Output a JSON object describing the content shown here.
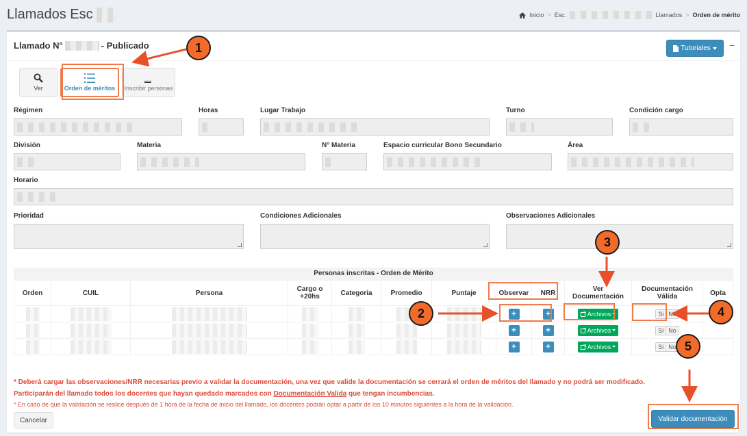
{
  "header": {
    "title": "Llamados Esc",
    "breadcrumb": {
      "home": "Inicio",
      "item2": "Esc.",
      "item3": "Llamados",
      "current": "Orden de mérito",
      "separator": ">"
    }
  },
  "box": {
    "title_prefix": "Llamado N°",
    "title_suffix": "- Publicado",
    "tutoriales": "Tutoriales",
    "collapse": "−"
  },
  "tools": [
    {
      "label": "Ver",
      "icon": "search-icon"
    },
    {
      "label": "Orden de méritos",
      "icon": "list-ordered-icon"
    },
    {
      "label": "Inscribir personas",
      "icon": "book-icon"
    }
  ],
  "form": {
    "regimen": "Régimen",
    "horas": "Horas",
    "lugar_trabajo": "Lugar Trabajo",
    "turno": "Turno",
    "condicion_cargo": "Condición cargo",
    "division": "División",
    "materia": "Materia",
    "n_materia": "N° Materia",
    "espacio_curricular": "Espacio curricular Bono Secundario",
    "area": "Área",
    "horario": "Horario",
    "prioridad": "Prioridad",
    "condiciones_adicionales": "Condiciones Adicionales",
    "observaciones_adicionales": "Observaciones Adicionales"
  },
  "table": {
    "title": "Personas inscritas - Orden de Mérito",
    "headers": {
      "orden": "Orden",
      "cuil": "CUIL",
      "persona": "Persona",
      "cargo": "Cargo o +20hs",
      "categoria": "Categoria",
      "promedio": "Promedio",
      "puntaje": "Puntaje",
      "observar": "Observar",
      "nrr": "NRR",
      "ver_doc": "Ver Documentación",
      "doc_valida": "Documentación Válida",
      "opta": "Opta"
    },
    "plus": "+",
    "archivos": "Archivos",
    "si": "Si",
    "no": "No"
  },
  "annotations": {
    "b1": "1",
    "b2": "2",
    "b3": "3",
    "b4": "4",
    "b5": "5"
  },
  "notes": {
    "line1": "* Deberá cargar las observaciones/NRR necesarias previo a validar la documentación, una vez que valide la documentación se cerrará el orden de méritos del llamado y no podrá ser modificado.",
    "line2_a": "Participarán del llamado todos los docentes que hayan quedado marcados con",
    "line2_link": "Documentación Valida",
    "line2_b": "que tengan incumbencias.",
    "line3": "* En caso de que la validación se realice después de 1 hora de la fecha de inicio del llamado, los docentes podrán optar a partir de los 10 minutos siguientes a la hora de la validación."
  },
  "buttons": {
    "cancel": "Cancelar",
    "validate": "Validar documentación"
  },
  "colors": {
    "primary": "#3c8dbc",
    "success": "#00a65a",
    "danger": "#dd4b39",
    "annotation": "#f26b2a"
  }
}
